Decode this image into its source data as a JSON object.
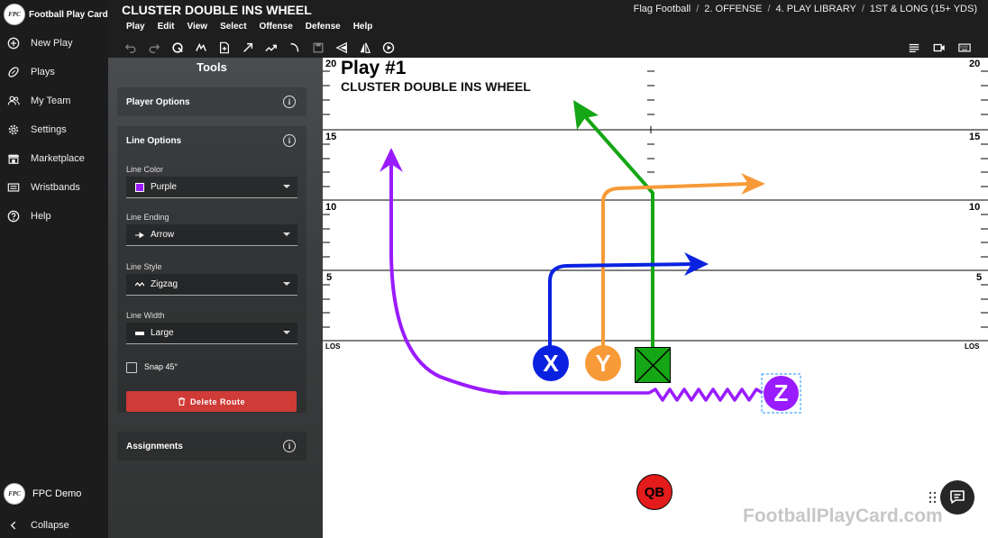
{
  "app": {
    "brand": "Football Play Card",
    "logo_text": "FPC",
    "nav": [
      {
        "label": "New Play",
        "icon": "plus-circle-icon"
      },
      {
        "label": "Plays",
        "icon": "football-icon"
      },
      {
        "label": "My Team",
        "icon": "team-icon"
      },
      {
        "label": "Settings",
        "icon": "gear-icon"
      },
      {
        "label": "Marketplace",
        "icon": "store-icon"
      },
      {
        "label": "Wristbands",
        "icon": "wristband-icon"
      },
      {
        "label": "Help",
        "icon": "help-icon"
      }
    ],
    "user": "FPC Demo",
    "collapse": "Collapse"
  },
  "header": {
    "title": "CLUSTER DOUBLE INS WHEEL",
    "breadcrumb": [
      "Flag Football",
      "2. OFFENSE",
      "4. PLAY LIBRARY",
      "1ST & LONG (15+ YDS)"
    ],
    "menu": [
      "Play",
      "Edit",
      "View",
      "Select",
      "Offense",
      "Defense",
      "Help"
    ],
    "toolbar": [
      "undo-icon",
      "redo-icon",
      "rotate-icon",
      "flip-icon",
      "add-player-icon",
      "arrow-route-icon",
      "zigzag-route-icon",
      "curve-route-icon",
      "save-icon",
      "mirror-left-icon",
      "mirror-icon",
      "play-icon"
    ],
    "toolbar_right": [
      "notes-icon",
      "video-icon",
      "keyboard-icon"
    ]
  },
  "tools": {
    "title": "Tools",
    "player_options": "Player Options",
    "line_options": "Line Options",
    "line_color_label": "Line Color",
    "line_color": "Purple",
    "line_color_hex": "#9a1bff",
    "line_ending_label": "Line Ending",
    "line_ending": "Arrow",
    "line_style_label": "Line Style",
    "line_style": "Zigzag",
    "line_width_label": "Line Width",
    "line_width": "Large",
    "snap_label": "Snap 45°",
    "snap_checked": false,
    "delete_label": "Delete Route",
    "assignments": "Assignments"
  },
  "field": {
    "play_number": "Play #1",
    "play_name": "CLUSTER DOUBLE INS WHEEL",
    "yard_numbers": {
      "top": "20",
      "y15": "15",
      "y10": "10",
      "y5": "5"
    },
    "los": "LOS",
    "watermark": "FootballPlayCard.com",
    "players": [
      {
        "label": "X",
        "color": "#0a22e0"
      },
      {
        "label": "Y",
        "color": "#f79a37"
      },
      {
        "label": "C",
        "color": "#14a614"
      },
      {
        "label": "Z",
        "color": "#9a1bff"
      },
      {
        "label": "QB",
        "color": "#e31b1b"
      }
    ]
  }
}
